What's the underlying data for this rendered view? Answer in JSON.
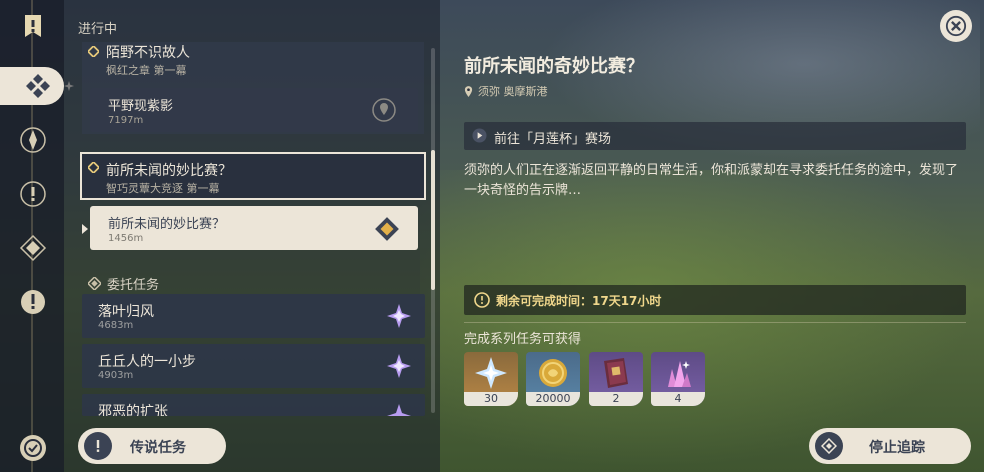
{
  "list": {
    "section_in_progress": "进行中",
    "section_commission": "委托任务",
    "quests": [
      {
        "title": "陌野不识故人",
        "subtitle": "枫红之章 第一幕",
        "step": {
          "title": "平野现紫影",
          "distance": "7197m"
        }
      },
      {
        "title": "前所未闻的妙比赛？",
        "subtitle": "智巧灵蕈大竞逐 第一幕",
        "step": {
          "title": "前所未闻的妙比赛？",
          "distance": "1456m"
        }
      }
    ],
    "commissions": [
      {
        "title": "落叶归风",
        "distance": "4683m"
      },
      {
        "title": "丘丘人的一小步",
        "distance": "4903m"
      },
      {
        "title": "邪恶的扩张",
        "distance": ""
      }
    ]
  },
  "detail": {
    "title": "前所未闻的奇妙比赛？",
    "location": "须弥 奥摩斯港",
    "objective": "前往「月莲杯」赛场",
    "description": "须弥的人们正在逐渐返回平静的日常生活，你和派蒙却在寻求委托任务的途中，发现了一块奇怪的告示牌…",
    "time_label": "剩余可完成时间：17天17小时",
    "rewards_title": "完成系列任务可获得",
    "rewards": [
      {
        "count": "30",
        "icon": "primogem-icon"
      },
      {
        "count": "20000",
        "icon": "mora-icon"
      },
      {
        "count": "2",
        "icon": "hero-wit-book-icon"
      },
      {
        "count": "4",
        "icon": "mystic-ore-crystal-icon"
      }
    ]
  },
  "buttons": {
    "legend_quests": "传说任务",
    "stop_tracking": "停止追踪"
  },
  "colors": {
    "accent": "#ece5d8",
    "dark": "#3b4354",
    "gold": "#f0d78c"
  }
}
